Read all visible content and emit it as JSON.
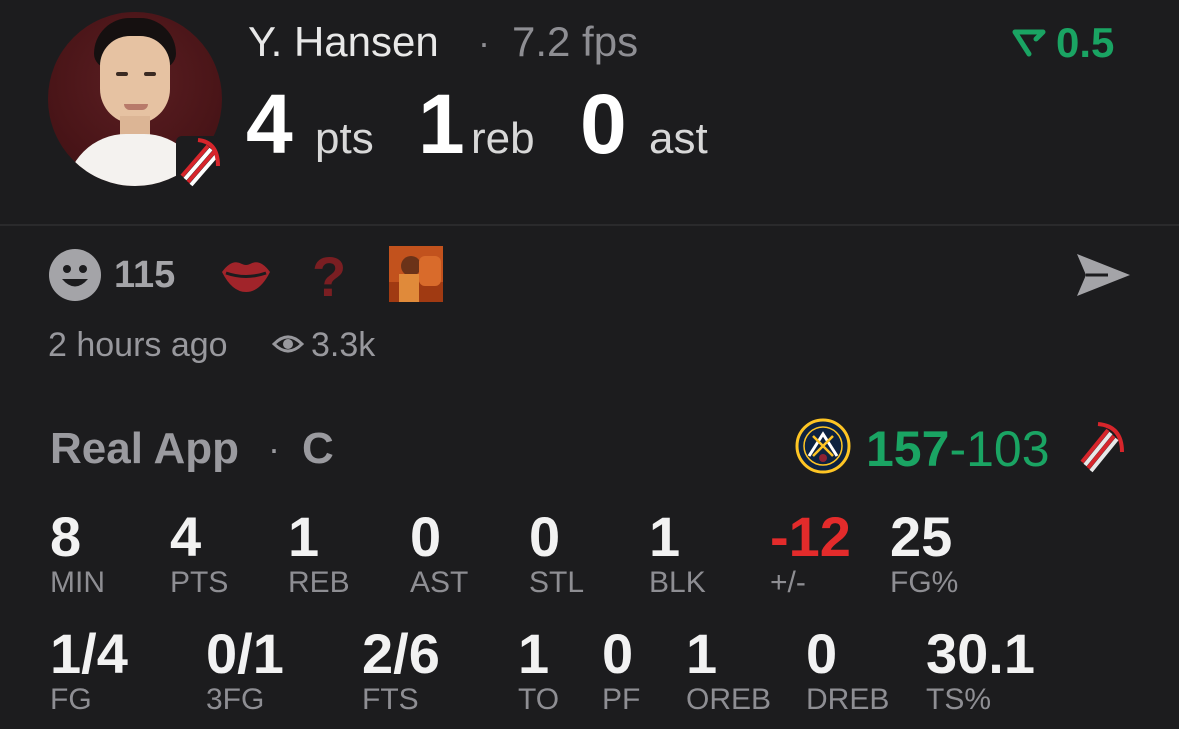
{
  "player": {
    "name": "Y. Hansen",
    "fps": "7.2 fps",
    "separator": "·",
    "pts_value": "4",
    "pts_label": "pts",
    "reb_value": "1",
    "reb_label": "reb",
    "ast_value": "0",
    "ast_label": "ast"
  },
  "trend": {
    "value": "0.5",
    "icon": "trend-down-icon",
    "color": "#1aa463"
  },
  "reactions": {
    "count": "115",
    "items": [
      "smiley-icon",
      "lips-icon",
      "question-icon",
      "meme-reaction"
    ],
    "time": "2 hours ago",
    "views": "3.3k"
  },
  "game": {
    "app": "Real App",
    "separator": "·",
    "position": "C",
    "home_score": "157",
    "dash": "-",
    "away_score": "103"
  },
  "stats_row1": [
    {
      "value": "8",
      "label": "MIN"
    },
    {
      "value": "4",
      "label": "PTS"
    },
    {
      "value": "1",
      "label": "REB"
    },
    {
      "value": "0",
      "label": "AST"
    },
    {
      "value": "0",
      "label": "STL"
    },
    {
      "value": "1",
      "label": "BLK"
    },
    {
      "value": "-12",
      "label": "+/-"
    },
    {
      "value": "25",
      "label": "FG%"
    }
  ],
  "stats_row2": [
    {
      "value": "1/4",
      "label": "FG"
    },
    {
      "value": "0/1",
      "label": "3FG"
    },
    {
      "value": "2/6",
      "label": "FTS"
    },
    {
      "value": "1",
      "label": "TO"
    },
    {
      "value": "0",
      "label": "PF"
    },
    {
      "value": "1",
      "label": "OREB"
    },
    {
      "value": "0",
      "label": "DREB"
    },
    {
      "value": "30.1",
      "label": "TS%"
    }
  ],
  "colors": {
    "background": "#1c1c1e",
    "positive": "#1aa463",
    "negative": "#e32b2b",
    "muted": "#8e8e93"
  }
}
